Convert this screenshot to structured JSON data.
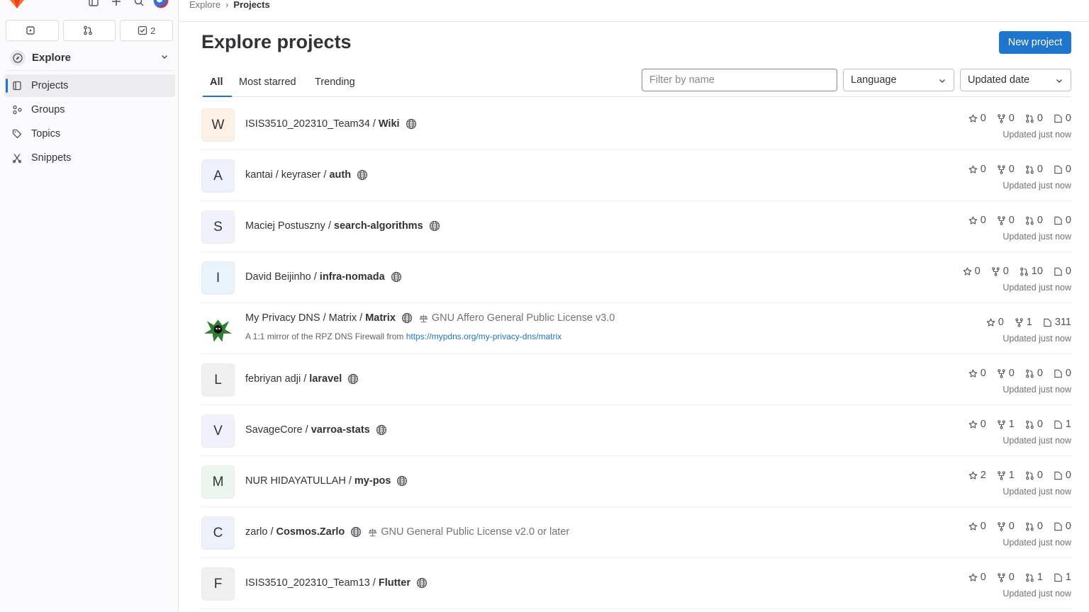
{
  "colors": {
    "accent": "#1f75cb",
    "brand": "#fc6d26"
  },
  "sidebar": {
    "counts": [
      {
        "icon": "issues-icon",
        "label": ""
      },
      {
        "icon": "merge-request-icon",
        "label": ""
      },
      {
        "icon": "todo-icon",
        "label": "2"
      }
    ],
    "section_title": "Explore",
    "items": [
      {
        "label": "Projects",
        "icon": "project-icon"
      },
      {
        "label": "Groups",
        "icon": "group-icon"
      },
      {
        "label": "Topics",
        "icon": "label-icon"
      },
      {
        "label": "Snippets",
        "icon": "snippet-icon"
      }
    ]
  },
  "breadcrumb": {
    "parent": "Explore",
    "sep": "›",
    "current": "Projects"
  },
  "header": {
    "title": "Explore projects",
    "new_button": "New project"
  },
  "tabs": [
    "All",
    "Most starred",
    "Trending"
  ],
  "filters": {
    "placeholder": "Filter by name",
    "language": "Language",
    "sort": "Updated date"
  },
  "projects": [
    {
      "avatar": "W",
      "avatar_bg": "#fdf1e5",
      "namespace": "ISIS3510_202310_Team34",
      "name": "Wiki",
      "stars": "0",
      "forks": "0",
      "mrs": "0",
      "issues": "0",
      "updated": "Updated just now"
    },
    {
      "avatar": "A",
      "avatar_bg": "#eef1fb",
      "namespace": "kantai / keyraser",
      "name": "auth",
      "stars": "0",
      "forks": "0",
      "mrs": "0",
      "issues": "0",
      "updated": "Updated just now"
    },
    {
      "avatar": "S",
      "avatar_bg": "#f1f1fb",
      "namespace": "Maciej Postuszny",
      "name": "search-algorithms",
      "stars": "0",
      "forks": "0",
      "mrs": "0",
      "issues": "0",
      "updated": "Updated just now"
    },
    {
      "avatar": "I",
      "avatar_bg": "#e9f3fb",
      "namespace": "David Beijinho",
      "name": "infra-nomada",
      "stars": "0",
      "forks": "0",
      "mrs": "10",
      "issues": "0",
      "updated": "Updated just now"
    },
    {
      "avatar": "",
      "avatar_bg": "#ffffff",
      "namespace": "My Privacy DNS / Matrix",
      "name": "Matrix",
      "license": "GNU Affero General Public License v3.0",
      "description": "A 1:1 mirror of the RPZ DNS Firewall from ",
      "description_link": "https://mypdns.org/my-privacy-dns/matrix",
      "stars": "0",
      "forks": "1",
      "issues": "311",
      "updated": "Updated just now"
    },
    {
      "avatar": "L",
      "avatar_bg": "#f0f0f0",
      "namespace": "febriyan adji",
      "name": "laravel",
      "stars": "0",
      "forks": "0",
      "mrs": "0",
      "issues": "0",
      "updated": "Updated just now"
    },
    {
      "avatar": "V",
      "avatar_bg": "#f1f1fb",
      "namespace": "SavageCore",
      "name": "varroa-stats",
      "stars": "0",
      "forks": "1",
      "mrs": "0",
      "issues": "1",
      "updated": "Updated just now"
    },
    {
      "avatar": "M",
      "avatar_bg": "#ecf6ee",
      "namespace": "NUR HIDAYATULLAH",
      "name": "my-pos",
      "stars": "2",
      "forks": "1",
      "mrs": "0",
      "issues": "0",
      "updated": "Updated just now"
    },
    {
      "avatar": "C",
      "avatar_bg": "#eef1fb",
      "namespace": "zarlo",
      "name": "Cosmos.Zarlo",
      "license": "GNU General Public License v2.0 or later",
      "stars": "0",
      "forks": "0",
      "mrs": "0",
      "issues": "0",
      "updated": "Updated just now"
    },
    {
      "avatar": "F",
      "avatar_bg": "#f0f0f0",
      "namespace": "ISIS3510_202310_Team13",
      "name": "Flutter",
      "stars": "0",
      "forks": "0",
      "mrs": "1",
      "issues": "1",
      "updated": "Updated just now"
    }
  ]
}
